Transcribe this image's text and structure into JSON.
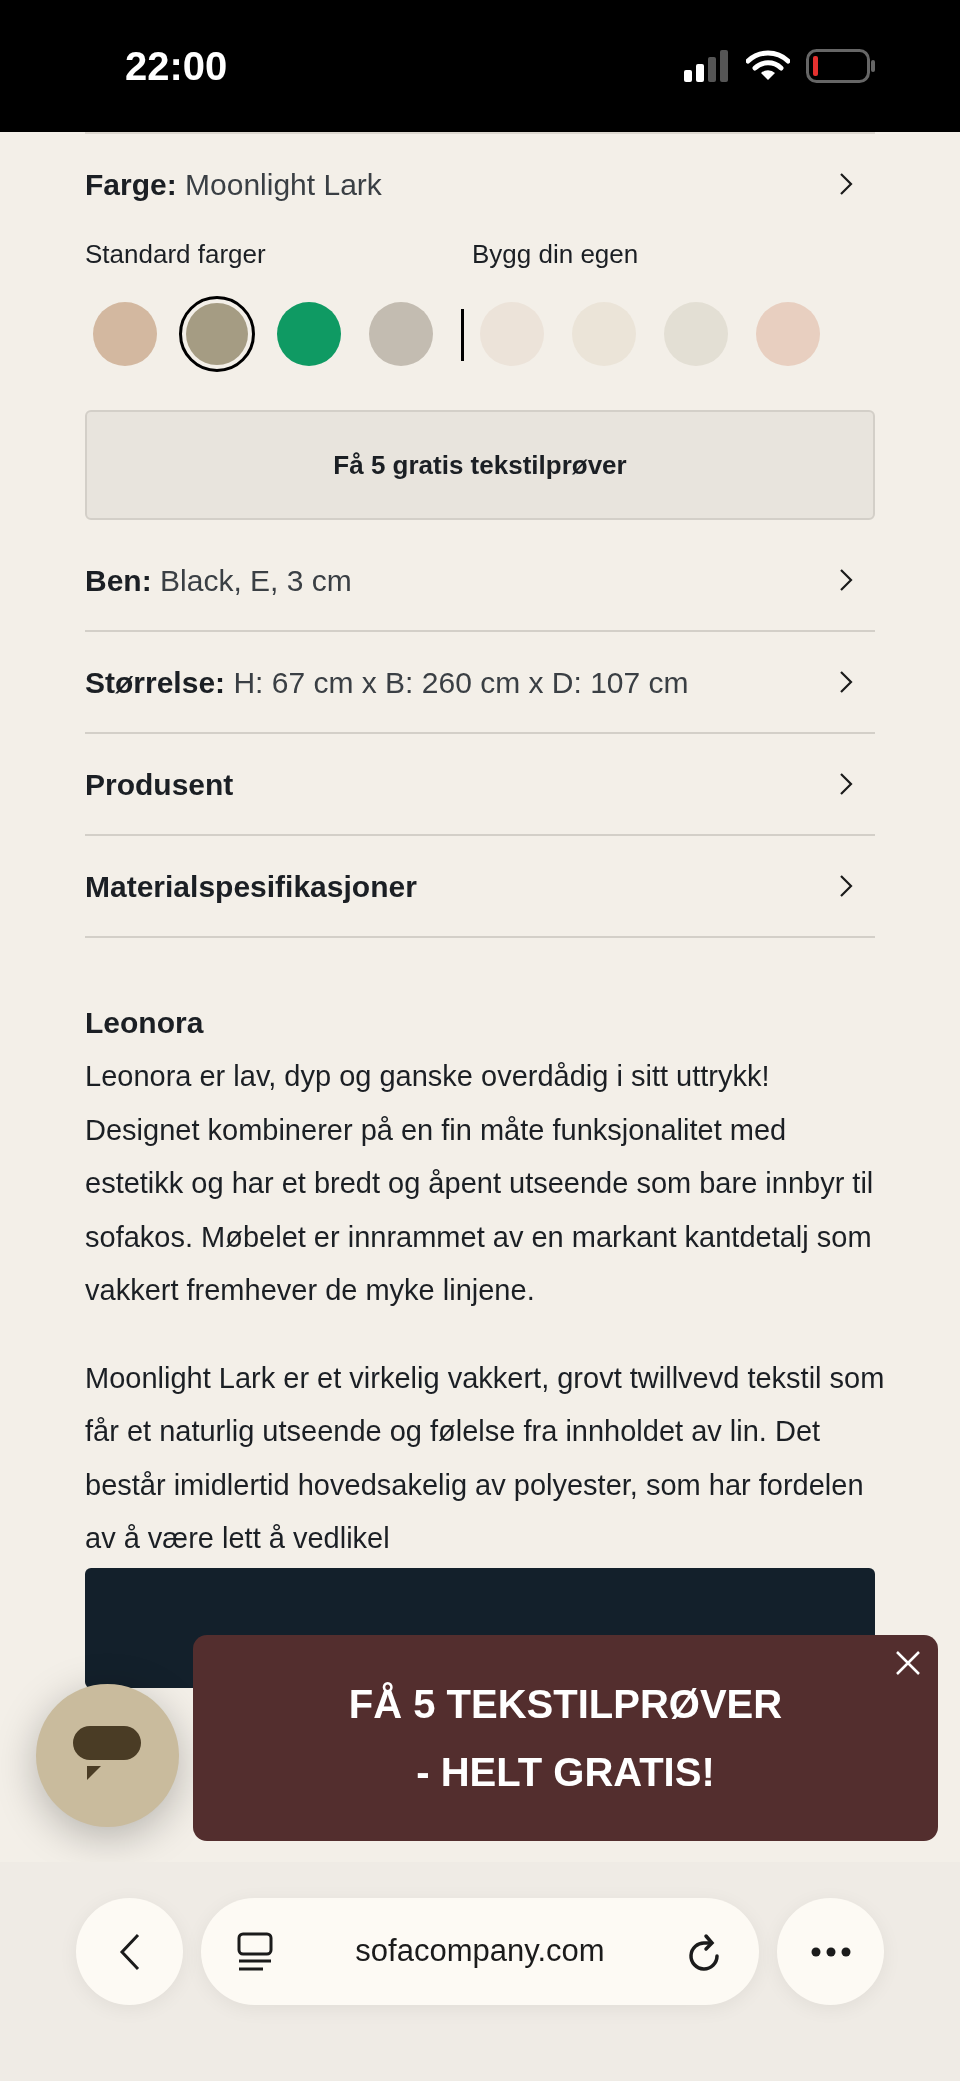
{
  "status_bar": {
    "time": "22:00"
  },
  "color_option": {
    "label": "Farge:",
    "value": "Moonlight Lark"
  },
  "swatch_groups": [
    {
      "label": "Standard farger",
      "swatches": [
        {
          "color": "#d3b8a0",
          "selected": false
        },
        {
          "color": "#a59c83",
          "selected": true
        },
        {
          "color": "#0f9a63",
          "selected": false
        },
        {
          "color": "#c3bcb1",
          "selected": false
        }
      ]
    },
    {
      "label": "Bygg din egen",
      "swatches": [
        {
          "color": "#ece3d9",
          "selected": false
        },
        {
          "color": "#ebe4d8",
          "selected": false
        },
        {
          "color": "#e3dfd4",
          "selected": false
        },
        {
          "color": "#e8cfc0",
          "selected": false
        }
      ]
    }
  ],
  "sample_button": "Få 5 gratis tekstilprøver",
  "options": [
    {
      "label": "Ben:",
      "value": "Black, E, 3 cm"
    },
    {
      "label": "Størrelse:",
      "value": "H: 67 cm x B: 260 cm x D: 107 cm"
    },
    {
      "label": "Produsent"
    },
    {
      "label": "Materialspesifikasjoner"
    }
  ],
  "description": {
    "title": "Leonora",
    "paragraphs": [
      "Leonora er lav, dyp og ganske overdådig i sitt uttrykk! Designet kombinerer på en fin måte funksjonalitet med estetikk og har et bredt og åpent utseende som bare innbyr til sofakos. Møbelet er innrammet av en markant kantdetalj som vakkert fremhever de myke linjene.",
      "Moonlight Lark er et virkelig vakkert, grovt twillvevd tekstil som får et naturlig utseende og følelse fra innholdet av lin. Det består imidlertid hovedsakelig av polyester, som har fordelen av å være lett å vedlikel"
    ]
  },
  "promo": {
    "lines": [
      "FÅ 5 TEKSTILPRØVER",
      "- HELT GRATIS!"
    ]
  },
  "browser": {
    "url": "sofacompany.com"
  }
}
